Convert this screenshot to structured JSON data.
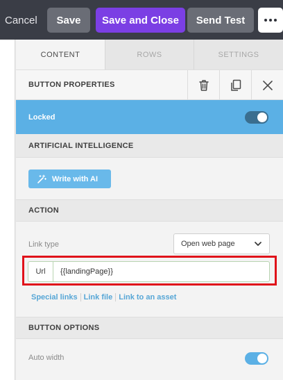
{
  "toolbar": {
    "cancel_label": "Cancel",
    "save_label": "Save",
    "save_close_label": "Save and Close",
    "send_test_label": "Send Test",
    "more_icon": "more-horizontal-icon",
    "accent": "#7b3fe4"
  },
  "tabs": [
    {
      "label": "CONTENT",
      "active": true
    },
    {
      "label": "ROWS",
      "active": false
    },
    {
      "label": "SETTINGS",
      "active": false
    }
  ],
  "button_properties": {
    "title": "BUTTON PROPERTIES",
    "icons": [
      "trash-icon",
      "copy-icon",
      "close-icon"
    ]
  },
  "locked": {
    "label": "Locked",
    "on": true,
    "color": "#5bb0e5"
  },
  "ai": {
    "title": "ARTIFICIAL INTELLIGENCE",
    "button_label": "Write with AI",
    "button_icon": "magic-wand-icon"
  },
  "action": {
    "title": "ACTION",
    "link_type_label": "Link type",
    "link_type_value": "Open web page",
    "url_tag": "Url",
    "url_value": "{{landingPage}}",
    "links": [
      "Special links",
      "Link file",
      "Link to an asset"
    ],
    "highlight_color": "#e0121a"
  },
  "button_options": {
    "title": "BUTTON OPTIONS",
    "auto_width_label": "Auto width",
    "auto_width_on": true
  }
}
